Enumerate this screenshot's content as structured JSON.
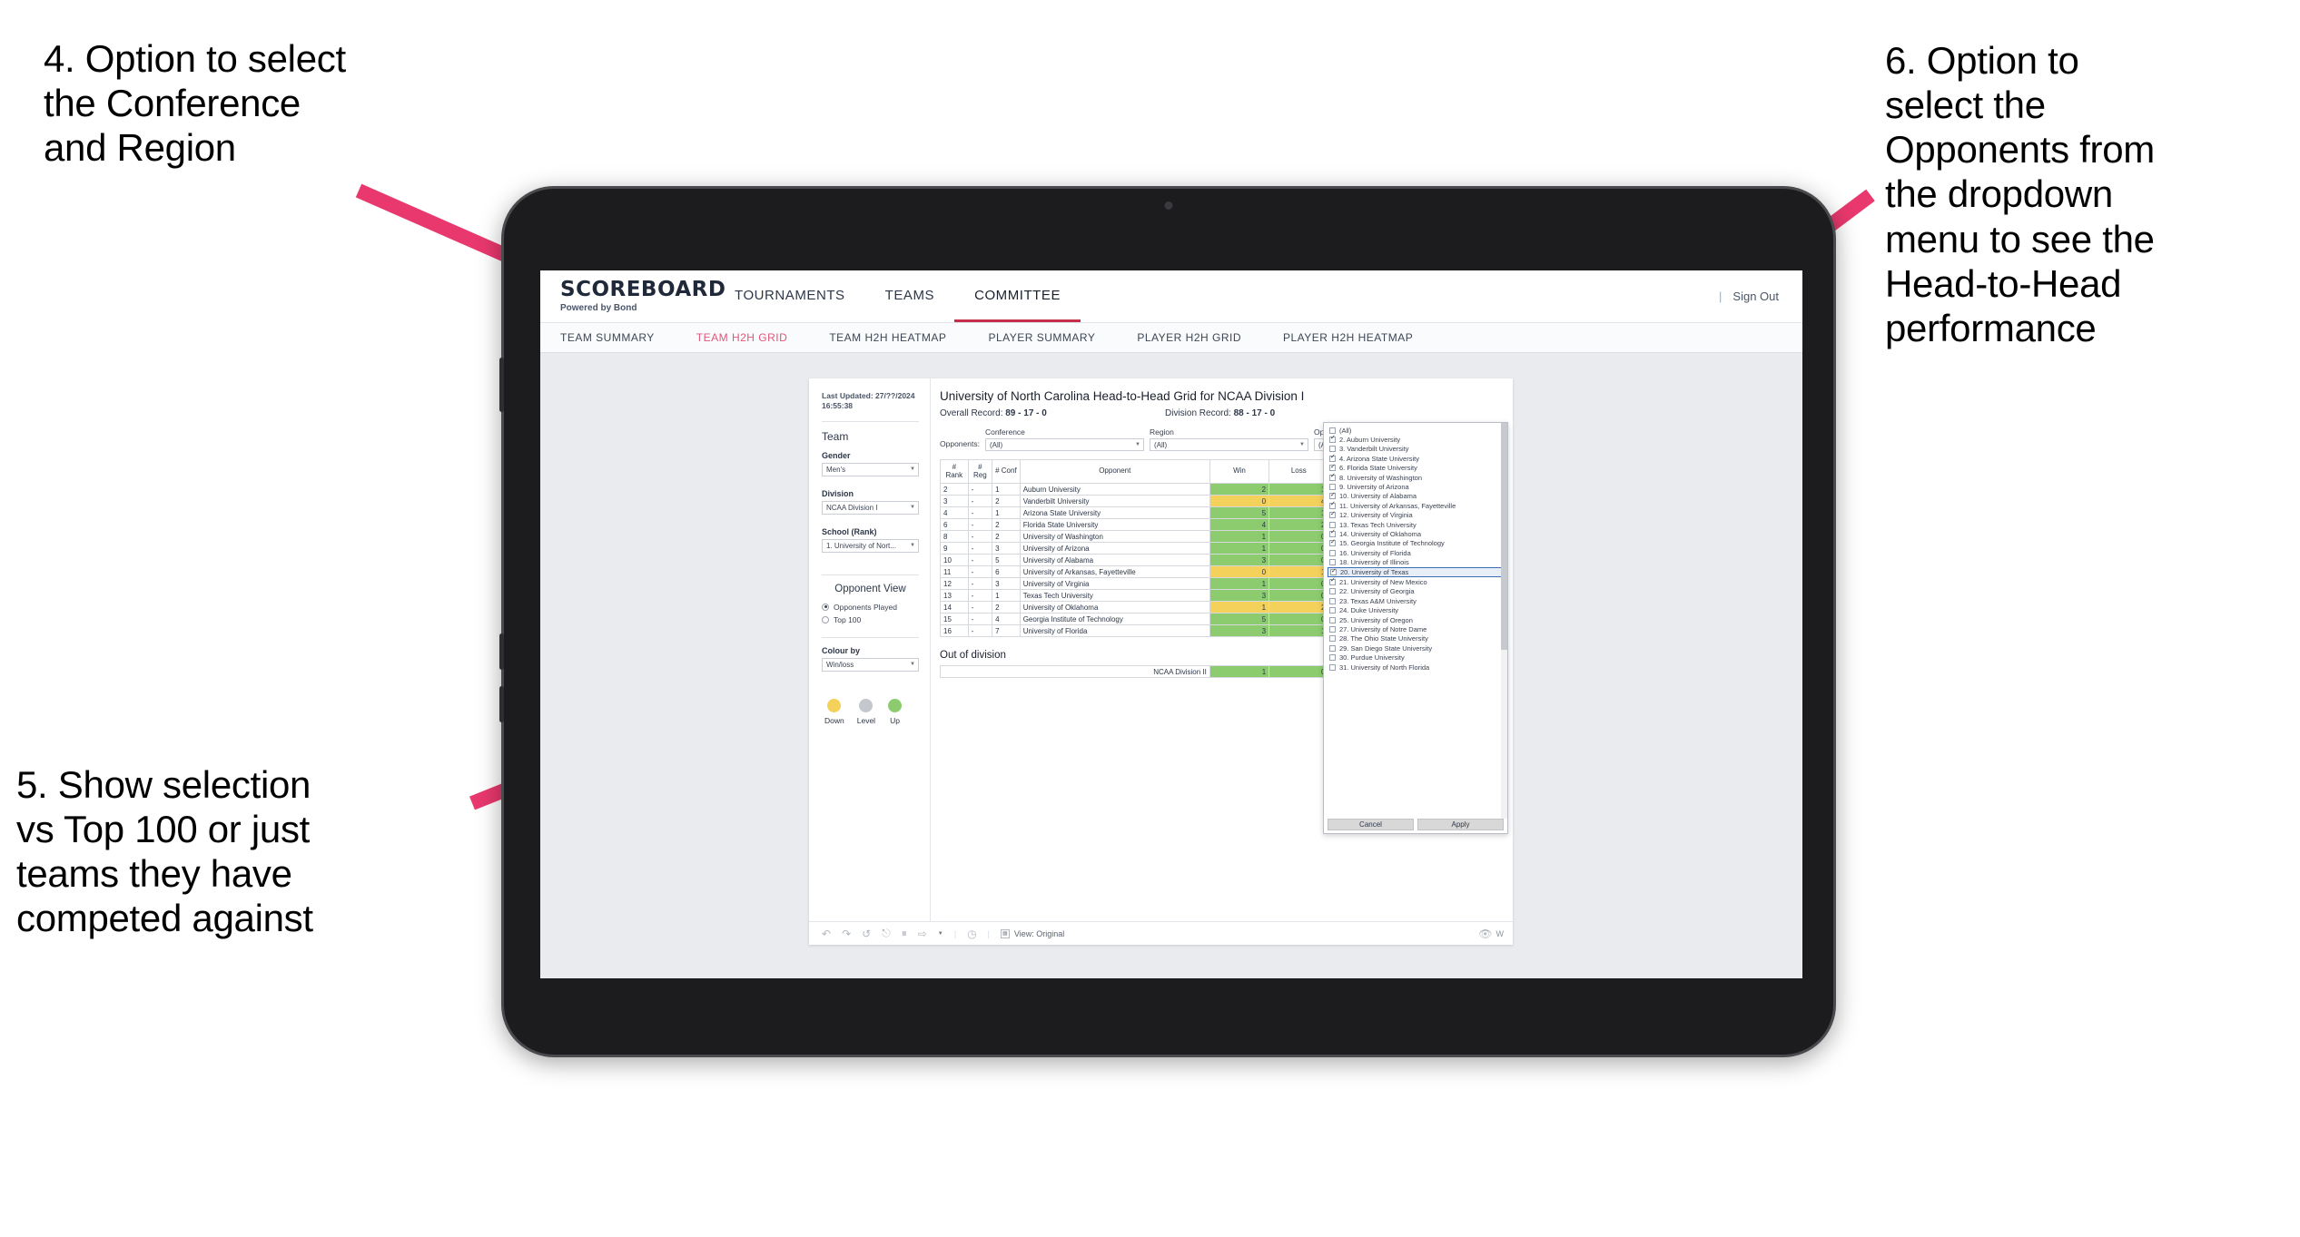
{
  "annotations": [
    {
      "id": "annot-4",
      "text": "4. Option to select\nthe Conference\nand Region"
    },
    {
      "id": "annot-5",
      "text": "5. Show selection\nvs Top 100 or just\nteams they have\ncompeted against"
    },
    {
      "id": "annot-6",
      "text": "6. Option to\nselect the\nOpponents from\nthe dropdown\nmenu to see the\nHead-to-Head\nperformance"
    }
  ],
  "colors": {
    "arrow": "#e8386d",
    "accent": "#c4304a",
    "subnav_active": "#e0567b",
    "up": "#8ccb6e",
    "down": "#f3d15b",
    "level": "#c4c8cd"
  },
  "header": {
    "brand_name": "SCOREBOARD",
    "brand_sub": "Powered by Bond",
    "nav": [
      {
        "label": "TOURNAMENTS",
        "active": false
      },
      {
        "label": "TEAMS",
        "active": false
      },
      {
        "label": "COMMITTEE",
        "active": true
      }
    ],
    "separator": "|",
    "sign_out": "Sign Out"
  },
  "subnav": [
    {
      "label": "TEAM SUMMARY",
      "active": false
    },
    {
      "label": "TEAM H2H GRID",
      "active": true
    },
    {
      "label": "TEAM H2H HEATMAP",
      "active": false
    },
    {
      "label": "PLAYER SUMMARY",
      "active": false
    },
    {
      "label": "PLAYER H2H GRID",
      "active": false
    },
    {
      "label": "PLAYER H2H HEATMAP",
      "active": false
    }
  ],
  "pane": {
    "last_updated": "Last Updated: 27/??/2024",
    "last_updated_time": "16:55:38",
    "team_heading": "Team",
    "gender_label": "Gender",
    "gender_value": "Men's",
    "division_label": "Division",
    "division_value": "NCAA Division I",
    "school_label": "School (Rank)",
    "school_value": "1. University of Nort...",
    "opponent_view_heading": "Opponent View",
    "opponent_view_options": [
      {
        "label": "Opponents Played",
        "selected": true
      },
      {
        "label": "Top 100",
        "selected": false
      }
    ],
    "colour_by_label": "Colour by",
    "colour_by_value": "Win/loss",
    "legend": [
      {
        "label": "Down",
        "color": "#f3d15b"
      },
      {
        "label": "Level",
        "color": "#c4c8cd"
      },
      {
        "label": "Up",
        "color": "#8ccb6e"
      }
    ]
  },
  "content": {
    "title": "University of North Carolina Head-to-Head Grid for NCAA Division I",
    "overall_record_label": "Overall Record:",
    "overall_record_value": "89 - 17 - 0",
    "division_record_label": "Division Record:",
    "division_record_value": "88 - 17 - 0",
    "opponents_inline_label": "Opponents:",
    "filters": [
      {
        "label": "Conference",
        "value": "(All)"
      },
      {
        "label": "Region",
        "value": "(All)"
      },
      {
        "label": "Opponent",
        "value": "(All)"
      }
    ],
    "out_of_division_label": "Out of division"
  },
  "chart_data": {
    "type": "table",
    "title": "University of North Carolina Head-to-Head Grid for NCAA Division I",
    "columns": [
      "# Rank",
      "# Reg",
      "# Conf",
      "Opponent",
      "Win",
      "Loss",
      ""
    ],
    "rows": [
      {
        "rank": "2",
        "reg": "-",
        "conf": "1",
        "opponent": "Auburn University",
        "win": "2",
        "loss": "1",
        "state": "up"
      },
      {
        "rank": "3",
        "reg": "-",
        "conf": "2",
        "opponent": "Vanderbilt University",
        "win": "0",
        "loss": "4",
        "state": "down"
      },
      {
        "rank": "4",
        "reg": "-",
        "conf": "1",
        "opponent": "Arizona State University",
        "win": "5",
        "loss": "1",
        "state": "up"
      },
      {
        "rank": "6",
        "reg": "-",
        "conf": "2",
        "opponent": "Florida State University",
        "win": "4",
        "loss": "2",
        "state": "up"
      },
      {
        "rank": "8",
        "reg": "-",
        "conf": "2",
        "opponent": "University of Washington",
        "win": "1",
        "loss": "0",
        "state": "up"
      },
      {
        "rank": "9",
        "reg": "-",
        "conf": "3",
        "opponent": "University of Arizona",
        "win": "1",
        "loss": "0",
        "state": "up"
      },
      {
        "rank": "10",
        "reg": "-",
        "conf": "5",
        "opponent": "University of Alabama",
        "win": "3",
        "loss": "0",
        "state": "up"
      },
      {
        "rank": "11",
        "reg": "-",
        "conf": "6",
        "opponent": "University of Arkansas, Fayetteville",
        "win": "0",
        "loss": "1",
        "state": "down"
      },
      {
        "rank": "12",
        "reg": "-",
        "conf": "3",
        "opponent": "University of Virginia",
        "win": "1",
        "loss": "0",
        "state": "up"
      },
      {
        "rank": "13",
        "reg": "-",
        "conf": "1",
        "opponent": "Texas Tech University",
        "win": "3",
        "loss": "0",
        "state": "up"
      },
      {
        "rank": "14",
        "reg": "-",
        "conf": "2",
        "opponent": "University of Oklahoma",
        "win": "1",
        "loss": "2",
        "state": "down"
      },
      {
        "rank": "15",
        "reg": "-",
        "conf": "4",
        "opponent": "Georgia Institute of Technology",
        "win": "5",
        "loss": "0",
        "state": "up"
      },
      {
        "rank": "16",
        "reg": "-",
        "conf": "7",
        "opponent": "University of Florida",
        "win": "3",
        "loss": "1",
        "state": "up"
      }
    ],
    "out_of_division": [
      {
        "opponent": "NCAA Division II",
        "win": "1",
        "loss": "0",
        "state": "up"
      }
    ]
  },
  "dropdown": {
    "items": [
      {
        "label": "(All)",
        "checked": false,
        "highlighted": false
      },
      {
        "label": "2. Auburn University",
        "checked": true,
        "highlighted": false
      },
      {
        "label": "3. Vanderbilt University",
        "checked": false,
        "highlighted": false
      },
      {
        "label": "4. Arizona State University",
        "checked": true,
        "highlighted": false
      },
      {
        "label": "6. Florida State University",
        "checked": true,
        "highlighted": false
      },
      {
        "label": "8. University of Washington",
        "checked": true,
        "highlighted": false
      },
      {
        "label": "9. University of Arizona",
        "checked": false,
        "highlighted": false
      },
      {
        "label": "10. University of Alabama",
        "checked": true,
        "highlighted": false
      },
      {
        "label": "11. University of Arkansas, Fayetteville",
        "checked": true,
        "highlighted": false
      },
      {
        "label": "12. University of Virginia",
        "checked": true,
        "highlighted": false
      },
      {
        "label": "13. Texas Tech University",
        "checked": false,
        "highlighted": false
      },
      {
        "label": "14. University of Oklahoma",
        "checked": true,
        "highlighted": false
      },
      {
        "label": "15. Georgia Institute of Technology",
        "checked": true,
        "highlighted": false
      },
      {
        "label": "16. University of Florida",
        "checked": false,
        "highlighted": false
      },
      {
        "label": "18. University of Illinois",
        "checked": false,
        "highlighted": false
      },
      {
        "label": "20. University of Texas",
        "checked": true,
        "highlighted": true
      },
      {
        "label": "21. University of New Mexico",
        "checked": true,
        "highlighted": false
      },
      {
        "label": "22. University of Georgia",
        "checked": false,
        "highlighted": false
      },
      {
        "label": "23. Texas A&M University",
        "checked": false,
        "highlighted": false
      },
      {
        "label": "24. Duke University",
        "checked": false,
        "highlighted": false
      },
      {
        "label": "25. University of Oregon",
        "checked": false,
        "highlighted": false
      },
      {
        "label": "27. University of Notre Dame",
        "checked": false,
        "highlighted": false
      },
      {
        "label": "28. The Ohio State University",
        "checked": false,
        "highlighted": false
      },
      {
        "label": "29. San Diego State University",
        "checked": false,
        "highlighted": false
      },
      {
        "label": "30. Purdue University",
        "checked": false,
        "highlighted": false
      },
      {
        "label": "31. University of North Florida",
        "checked": false,
        "highlighted": false
      }
    ],
    "cancel_label": "Cancel",
    "apply_label": "Apply"
  },
  "toolbar": {
    "icons": [
      "undo-icon",
      "redo-icon",
      "revert-icon",
      "refresh-icon",
      "pause-icon",
      "share-icon",
      "chevron-down-icon"
    ],
    "timer_icon": "timer-icon",
    "view_label": "View: Original",
    "watch_label": "W"
  }
}
